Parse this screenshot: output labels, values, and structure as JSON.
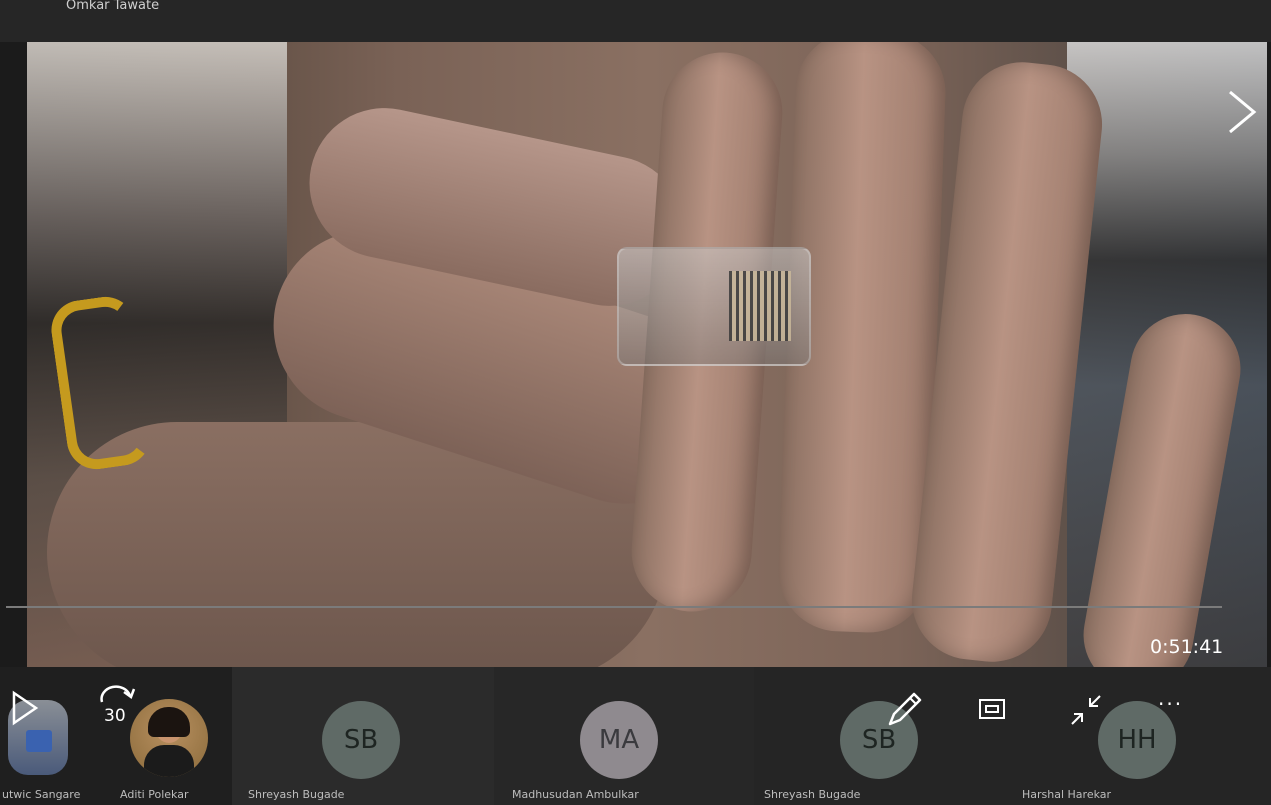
{
  "presenter_name": "Omkar Tawate",
  "playback": {
    "timecode": "0:51:41",
    "skip_seconds": "30"
  },
  "participants": [
    {
      "name": "utwic Sangare",
      "initials": ""
    },
    {
      "name": "Aditi Polekar",
      "initials": ""
    },
    {
      "name": "Shreyash Bugade",
      "initials": "SB"
    },
    {
      "name": "Madhusudan Ambulkar",
      "initials": "MA"
    },
    {
      "name": "Shreyash Bugade",
      "initials": "SB"
    },
    {
      "name": "Harshal Harekar",
      "initials": "HH"
    }
  ],
  "icons": {
    "play": "play-icon",
    "skip": "skip-forward-30-icon",
    "pen": "pen-icon",
    "pip": "picture-in-picture-icon",
    "collapse": "collapse-icon",
    "more": "more-options-icon",
    "next": "chevron-right-icon"
  },
  "more_glyph": "···",
  "colors": {
    "avatar_green": "#5f6a66",
    "avatar_gray": "#8f8a8f",
    "background": "#1b1b1b",
    "strip": "#262626"
  }
}
